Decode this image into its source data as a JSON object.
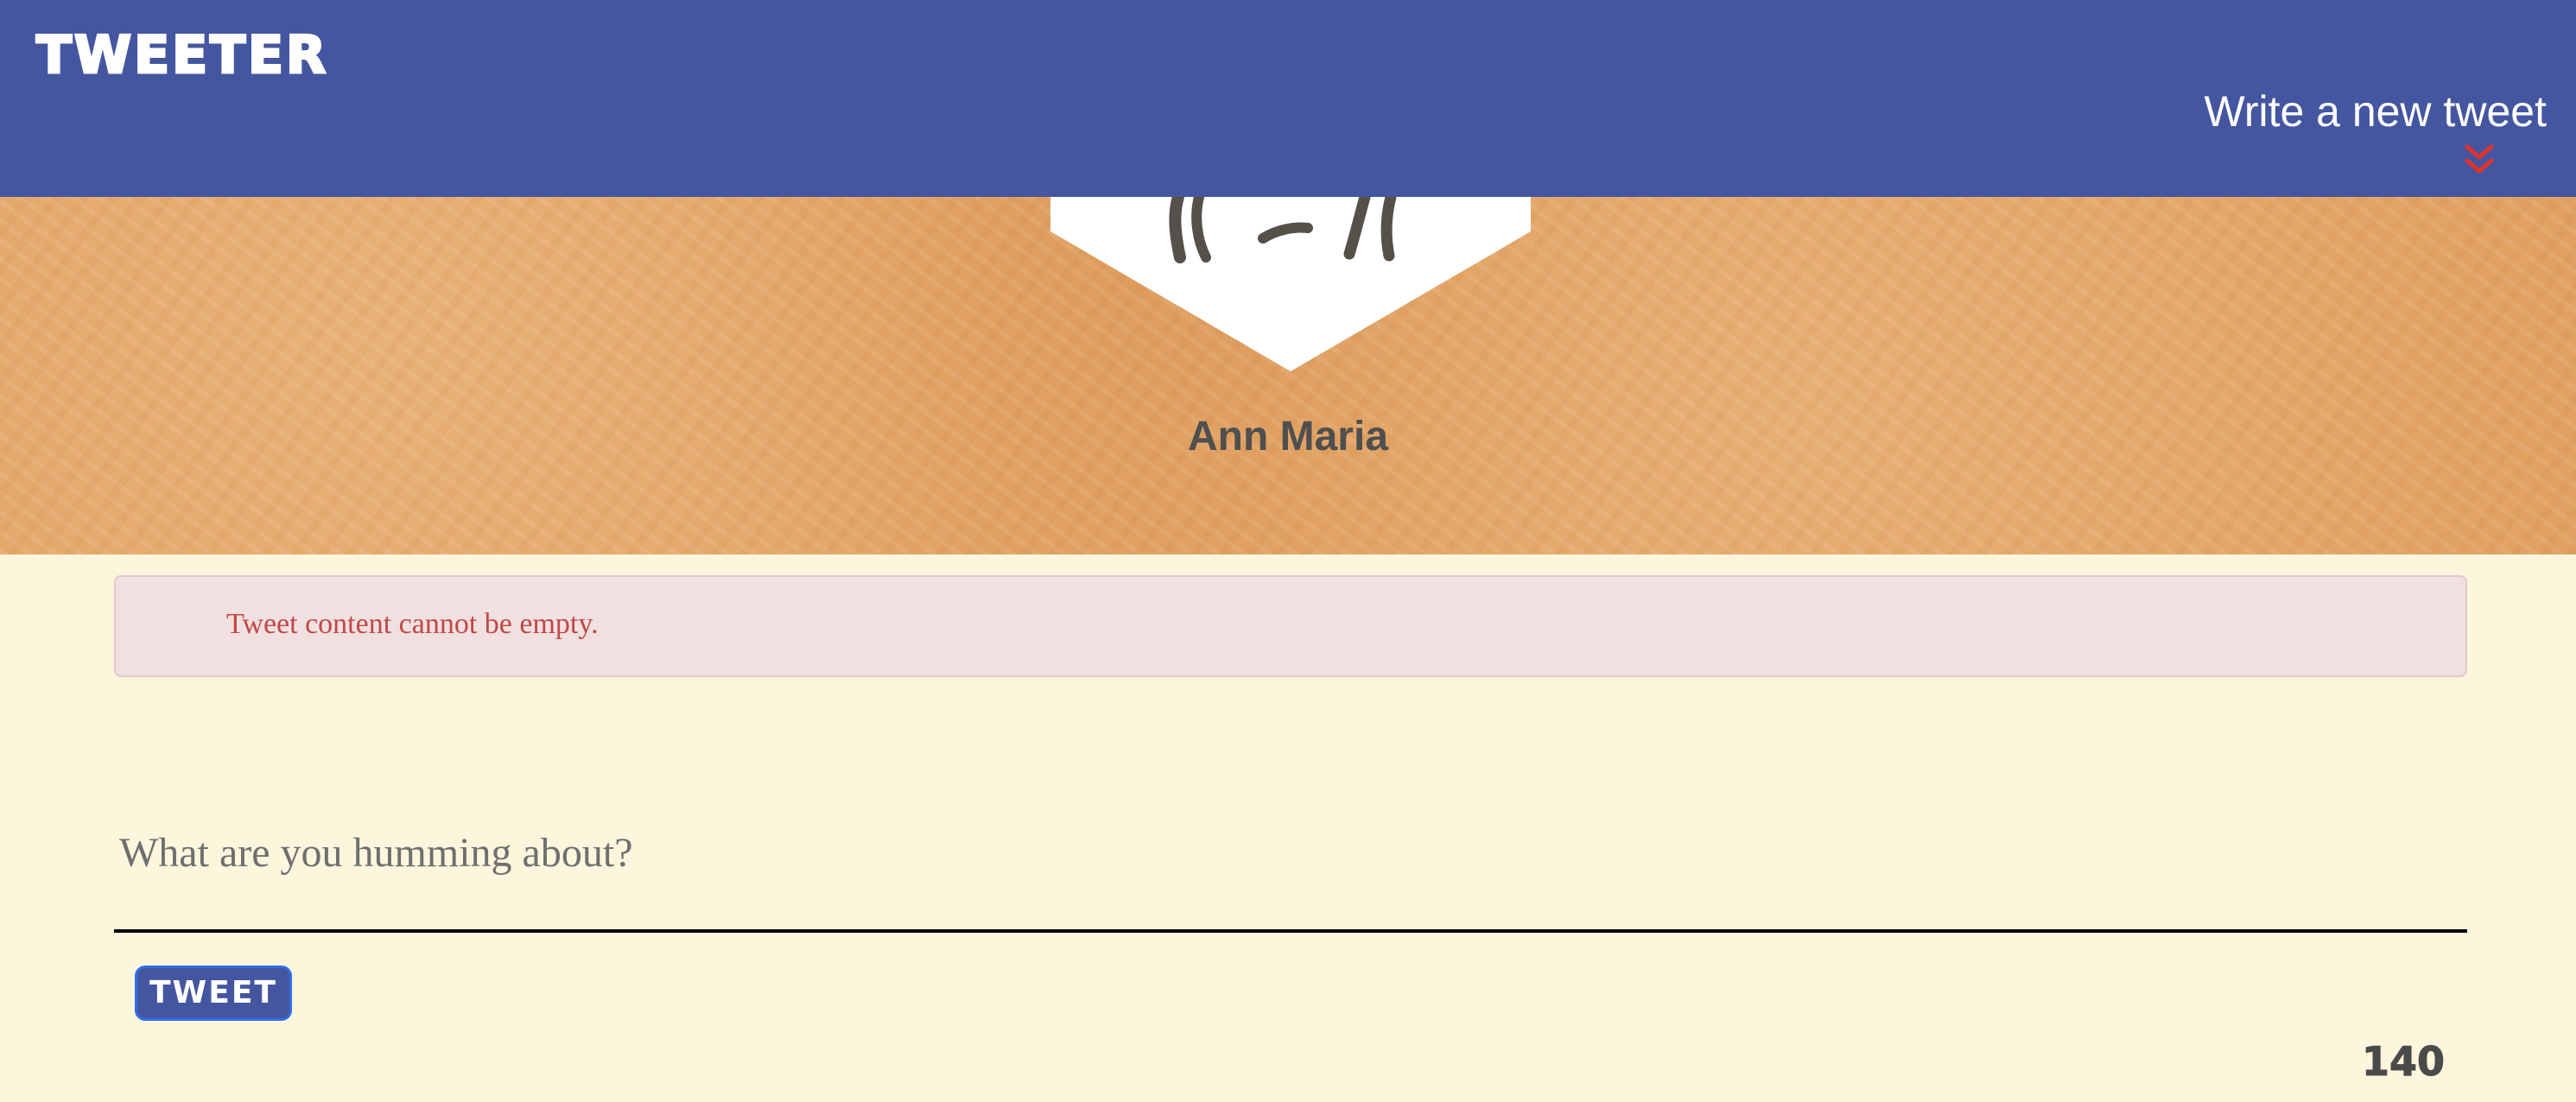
{
  "navbar": {
    "logo": "TWEETER",
    "compose_label": "Write a new tweet",
    "compose_icon": "double-chevron-down-icon",
    "compose_icon_color": "#e0322c",
    "background": "#4556a0"
  },
  "profile": {
    "name": "Ann Maria",
    "avatar_icon": "avatar-icon",
    "header_color": "#e0a060"
  },
  "alert": {
    "message": "Tweet content cannot be empty.",
    "text_color": "#c04848",
    "background": "#f0e0df"
  },
  "compose": {
    "placeholder": "What are you humming about?",
    "value": "",
    "submit_label": "TWEET",
    "char_count": "140"
  },
  "page": {
    "background": "#fdf6dd"
  }
}
